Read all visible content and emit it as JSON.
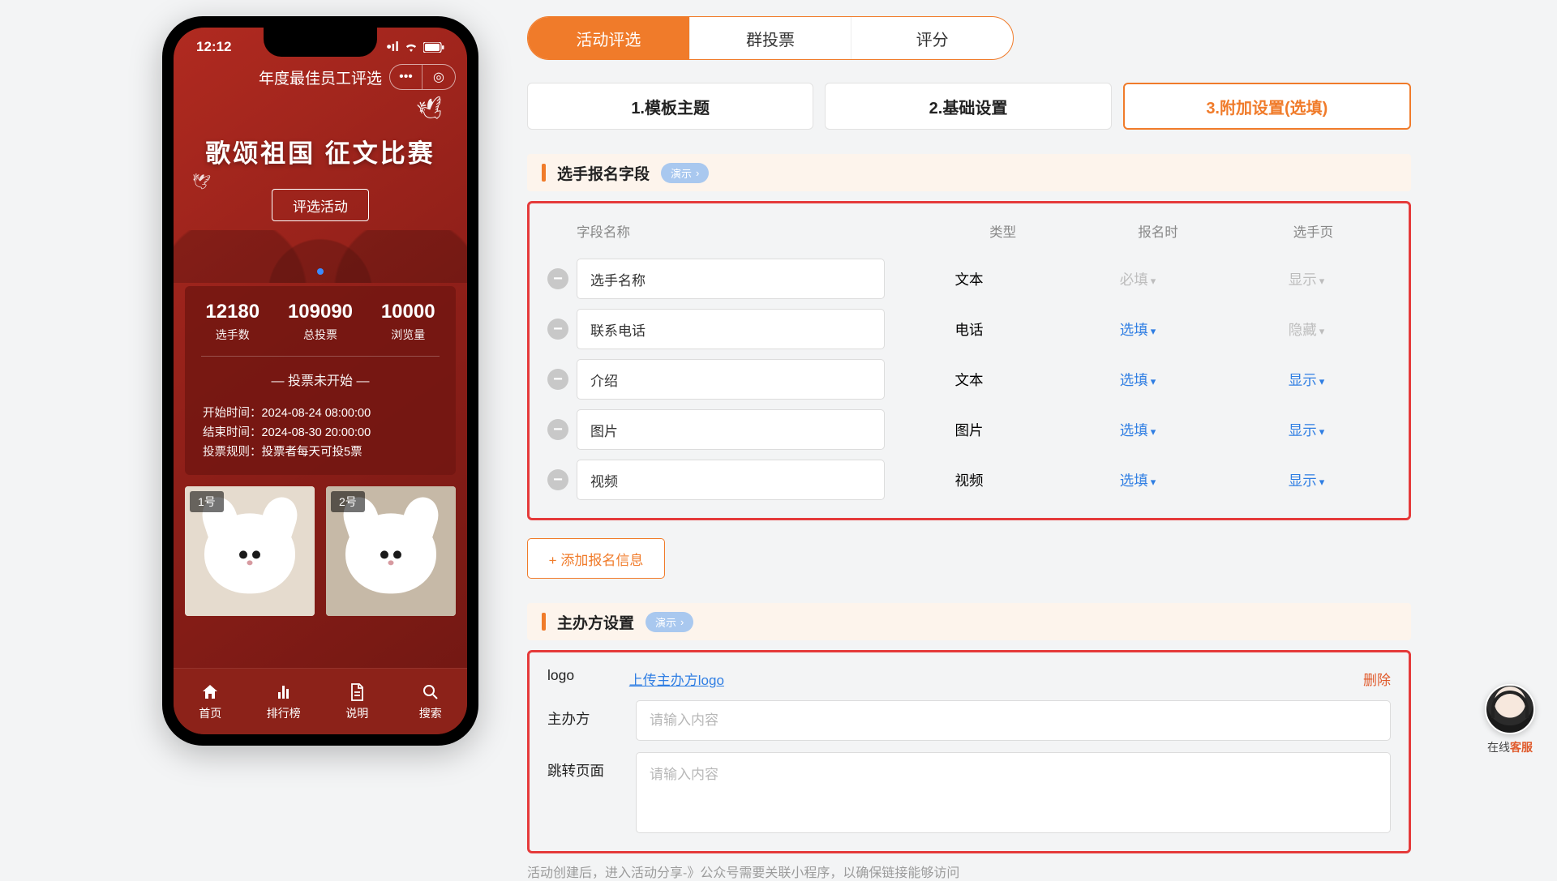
{
  "phone": {
    "time": "12:12",
    "appTitle": "年度最佳员工评选",
    "bannerTitle": "歌颂祖国 征文比赛",
    "bannerBtn": "评选活动",
    "stats": [
      {
        "num": "12180",
        "lbl": "选手数"
      },
      {
        "num": "109090",
        "lbl": "总投票"
      },
      {
        "num": "10000",
        "lbl": "浏览量"
      }
    ],
    "notStarted": "— 投票未开始 —",
    "info": [
      {
        "k": "开始时间：",
        "v": "2024-08-24 08:00:00"
      },
      {
        "k": "结束时间：",
        "v": "2024-08-30 20:00:00"
      },
      {
        "k": "投票规则：",
        "v": "投票者每天可投5票"
      }
    ],
    "catTags": [
      "1号",
      "2号"
    ],
    "nav": [
      "首页",
      "排行榜",
      "说明",
      "搜索"
    ]
  },
  "mainTabs": [
    "活动评选",
    "群投票",
    "评分"
  ],
  "stepTabs": [
    "1.模板主题",
    "2.基础设置",
    "3.附加设置(选填)"
  ],
  "sec1": {
    "title": "选手报名字段",
    "demo": "演示"
  },
  "fieldHead": {
    "c1": "字段名称",
    "c2": "类型",
    "c3": "报名时",
    "c4": "选手页"
  },
  "fields": [
    {
      "name": "选手名称",
      "type": "文本",
      "reg": "必填",
      "regDisabled": true,
      "show": "显示",
      "showDisabled": true
    },
    {
      "name": "联系电话",
      "type": "电话",
      "reg": "选填",
      "regDisabled": false,
      "show": "隐藏",
      "showDisabled": true
    },
    {
      "name": "介绍",
      "type": "文本",
      "reg": "选填",
      "regDisabled": false,
      "show": "显示",
      "showDisabled": false
    },
    {
      "name": "图片",
      "type": "图片",
      "reg": "选填",
      "regDisabled": false,
      "show": "显示",
      "showDisabled": false
    },
    {
      "name": "视频",
      "type": "视频",
      "reg": "选填",
      "regDisabled": false,
      "show": "显示",
      "showDisabled": false
    }
  ],
  "addBtn": "+ 添加报名信息",
  "sec2": {
    "title": "主办方设置",
    "demo": "演示"
  },
  "org": {
    "logoLabel": "logo",
    "uploadText": "上传主办方logo",
    "deleteText": "删除",
    "orgLabel": "主办方",
    "orgPh": "请输入内容",
    "jumpLabel": "跳转页面",
    "jumpPh": "请输入内容"
  },
  "hint": "活动创建后，进入活动分享-》公众号需要关联小程序，以确保链接能够访问",
  "cs": {
    "text1": "在线",
    "text2": "客服"
  }
}
